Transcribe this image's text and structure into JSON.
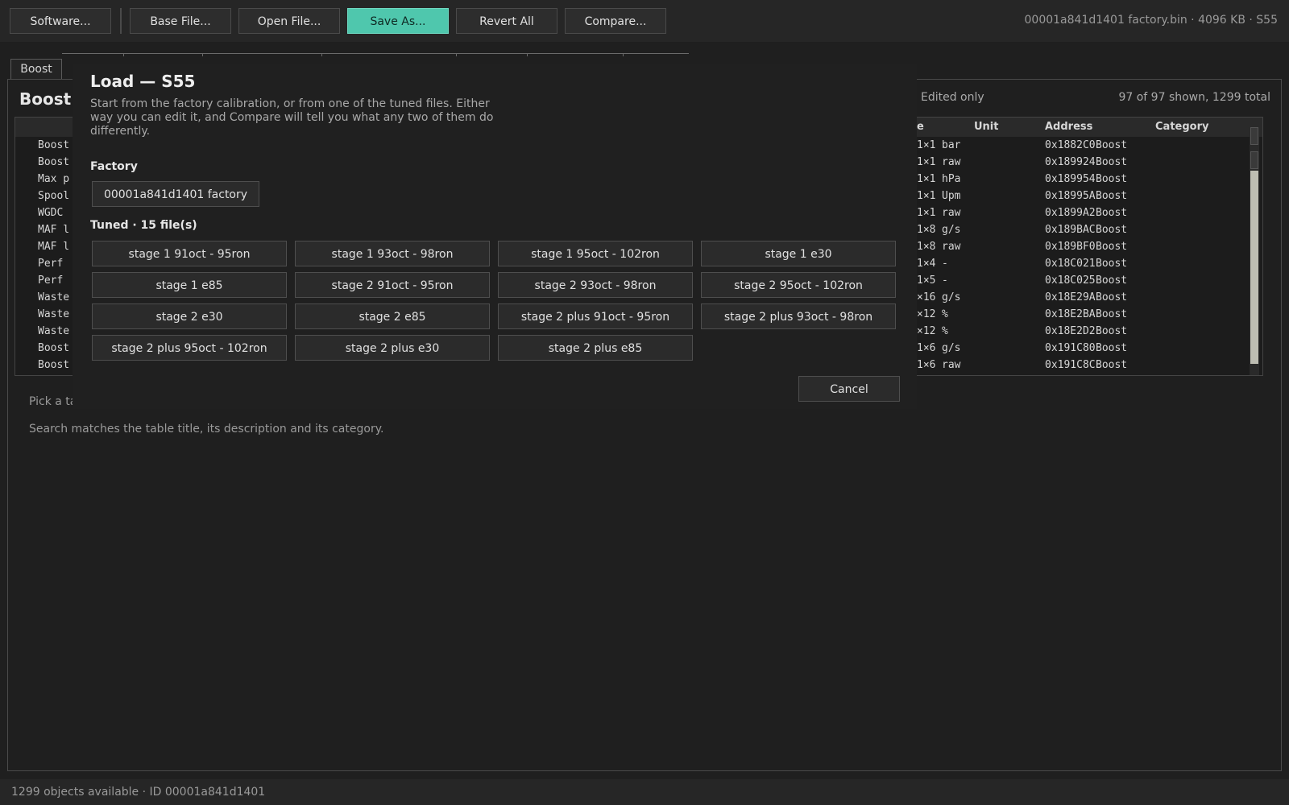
{
  "toolbar": {
    "buttons": [
      "Software...",
      "Base File...",
      "Open File...",
      "Save As...",
      "Revert All",
      "Compare..."
    ],
    "file_info": "00001a841d1401 factory.bin  ·  4096 KB  ·  S55"
  },
  "tabs": {
    "active": "Boost"
  },
  "panel": {
    "title": "Boost",
    "edited_only_label": "Edited only",
    "shown_count": "97 of 97 shown, 1299 total"
  },
  "table": {
    "headers": {
      "size": "e",
      "unit": "Unit",
      "address": "Address",
      "category": "Category"
    },
    "rows": [
      {
        "name": "Boost",
        "size": "1×1",
        "unit": "bar",
        "address": "0x1882C0",
        "category": "Boost"
      },
      {
        "name": "Boost",
        "size": "1×1",
        "unit": "raw",
        "address": "0x189924",
        "category": "Boost"
      },
      {
        "name": "Max p",
        "size": "1×1",
        "unit": "hPa",
        "address": "0x189954",
        "category": "Boost"
      },
      {
        "name": "Spool",
        "size": "1×1",
        "unit": "Upm",
        "address": "0x18995A",
        "category": "Boost"
      },
      {
        "name": "WGDC ",
        "size": "1×1",
        "unit": "raw",
        "address": "0x1899A2",
        "category": "Boost"
      },
      {
        "name": "MAF l",
        "size": "1×8",
        "unit": "g/s",
        "address": "0x189BAC",
        "category": "Boost"
      },
      {
        "name": "MAF l",
        "size": "1×8",
        "unit": "raw",
        "address": "0x189BF0",
        "category": "Boost"
      },
      {
        "name": "Perf ",
        "size": "1×4",
        "unit": "-",
        "address": "0x18C021",
        "category": "Boost"
      },
      {
        "name": "Perf ",
        "size": "1×5",
        "unit": "-",
        "address": "0x18C025",
        "category": "Boost"
      },
      {
        "name": "Waste",
        "size": "×16",
        "unit": "g/s",
        "address": "0x18E29A",
        "category": "Boost"
      },
      {
        "name": "Waste",
        "size": "×12",
        "unit": "%",
        "address": "0x18E2BA",
        "category": "Boost"
      },
      {
        "name": "Waste",
        "size": "×12",
        "unit": "%",
        "address": "0x18E2D2",
        "category": "Boost"
      },
      {
        "name": "Boost",
        "size": "1×6",
        "unit": "g/s",
        "address": "0x191C80",
        "category": "Boost"
      },
      {
        "name": "Boost",
        "size": "1×6",
        "unit": "raw",
        "address": "0x191C8C",
        "category": "Boost"
      }
    ]
  },
  "hints": {
    "pick": "Pick a ta",
    "search": "Search matches the table title, its description and its category."
  },
  "status": {
    "text": "1299 objects available  ·  ID 00001a841d1401"
  },
  "modal": {
    "title": "Load — S55",
    "description": "Start from the factory calibration, or from one of the tuned files. Either way you can edit it, and Compare will tell you what any two of them do differently.",
    "factory_label": "Factory",
    "factory_file": "00001a841d1401 factory",
    "tuned_label": "Tuned  ·  15 file(s)",
    "tuned_files": [
      "stage 1 91oct - 95ron",
      "stage 1 93oct - 98ron",
      "stage 1 95oct - 102ron",
      "stage 1 e30",
      "stage 1 e85",
      "stage 2 91oct - 95ron",
      "stage 2 93oct - 98ron",
      "stage 2 95oct - 102ron",
      "stage 2 e30",
      "stage 2 e85",
      "stage 2 plus 91oct - 95ron",
      "stage 2 plus 93oct - 98ron",
      "stage 2 plus 95oct - 102ron",
      "stage 2 plus e30",
      "stage 2 plus e85"
    ],
    "cancel_label": "Cancel"
  },
  "colors": {
    "accent": "#4fc7ad",
    "background": "#1f1f1f",
    "thumb": "#bdbdb2"
  }
}
